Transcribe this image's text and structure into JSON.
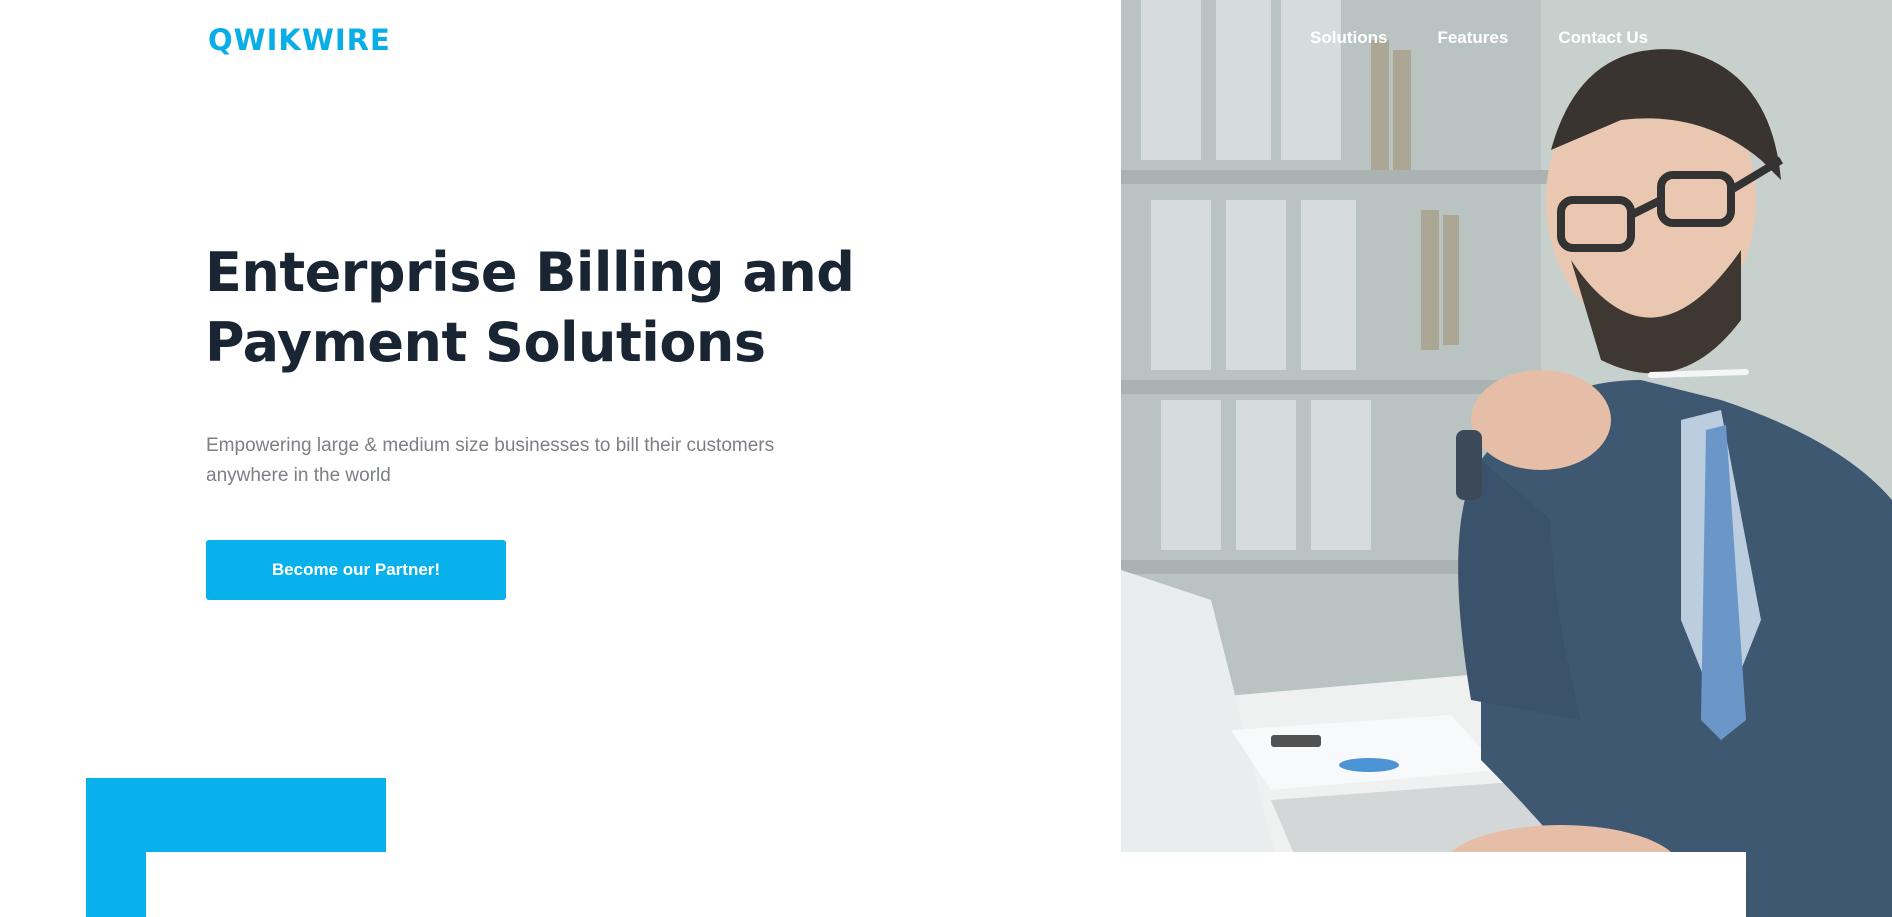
{
  "brand": {
    "logo_text": "QWIKWIRE",
    "accent_color": "#08b1ec"
  },
  "nav": {
    "items": [
      {
        "label": "Solutions"
      },
      {
        "label": "Features"
      },
      {
        "label": "Contact Us"
      }
    ]
  },
  "hero": {
    "headline_line1": "Enterprise Billing and",
    "headline_line2": "Payment Solutions",
    "subtitle": "Empowering large & medium size businesses to bill their customers anywhere in the world",
    "cta_label": "Become our Partner!",
    "headline_color": "#1a2533",
    "subtitle_color": "#7c7f86"
  },
  "icons": {
    "logo": "qwikwire-wordmark"
  }
}
